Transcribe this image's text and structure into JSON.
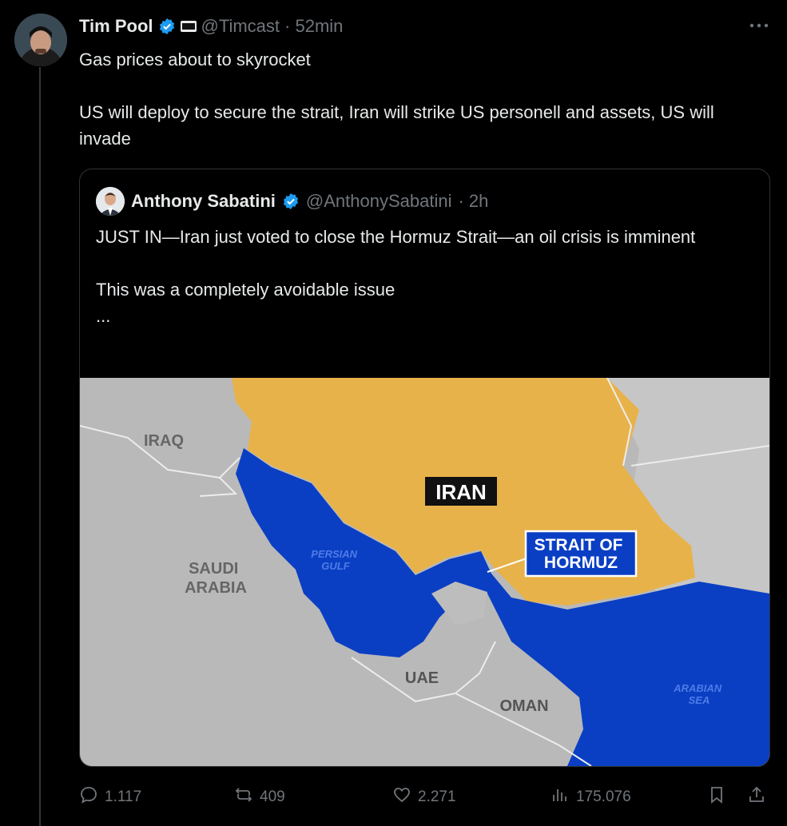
{
  "tweet": {
    "author_name": "Tim Pool",
    "handle": "@Timcast",
    "time": "· 52min",
    "affiliation_badge": "TIMCAST",
    "text": "Gas prices about to skyrocket\n\nUS will deploy to secure the strait, Iran will strike US personell and assets, US will invade",
    "icons": {
      "verified": "verified-badge-icon",
      "more": "more-icon"
    }
  },
  "quote": {
    "author_name": "Anthony Sabatini",
    "handle": "@AnthonySabatini",
    "time": "· 2h",
    "text": "JUST IN—Iran just voted to close the Hormuz Strait—an oil crisis is imminent\n\nThis was a completely avoidable issue\n...",
    "map_labels": {
      "iraq": "IRAQ",
      "iran": "IRAN",
      "saudi": "SAUDI\nARABIA",
      "persian_gulf": "PERSIAN\nGULF",
      "strait": "STRAIT OF\nHORMUZ",
      "uae": "UAE",
      "oman": "OMAN",
      "arabian_sea": "ARABIAN\nSEA"
    },
    "colors": {
      "iran": "#e8b24a",
      "water": "#0a3fc4",
      "land": "#b9b9b9"
    }
  },
  "actions": {
    "replies": "1.117",
    "reposts": "409",
    "likes": "2.271",
    "views": "175.076"
  }
}
